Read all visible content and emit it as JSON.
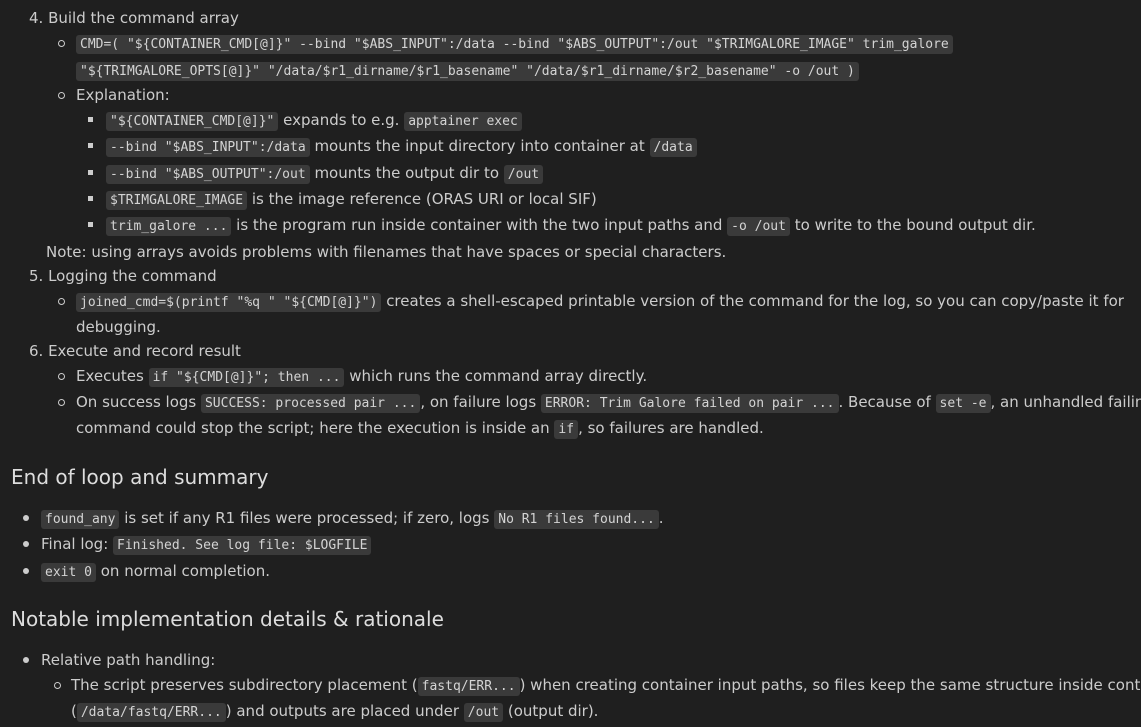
{
  "steps": {
    "step4_title": "4. Build the command array",
    "cmd_code_1": "CMD=( \"${CONTAINER_CMD[@]}\" --bind \"$ABS_INPUT\":/data --bind \"$ABS_OUTPUT\":/out \"$TRIMGALORE_IMAGE\" trim_galore",
    "cmd_code_2": "\"${TRIMGALORE_OPTS[@]}\" \"/data/$r1_dirname/$r1_basename\" \"/data/$r1_dirname/$r2_basename\" -o /out )",
    "explanation_label": "Explanation:",
    "exp1_code": "\"${CONTAINER_CMD[@]}\"",
    "exp1_text": " expands to e.g. ",
    "exp1_code2": "apptainer exec",
    "exp2_code": "--bind \"$ABS_INPUT\":/data",
    "exp2_text": " mounts the input directory into container at ",
    "exp2_code2": "/data",
    "exp3_code": "--bind \"$ABS_OUTPUT\":/out",
    "exp3_text": " mounts the output dir to ",
    "exp3_code2": "/out",
    "exp4_code": "$TRIMGALORE_IMAGE",
    "exp4_text": " is the image reference (ORAS URI or local SIF)",
    "exp5_code": "trim_galore ...",
    "exp5_text": " is the program run inside container with the two input paths and ",
    "exp5_code2": "-o /out",
    "exp5_text2": " to write to the bound output dir.",
    "note": "Note: using arrays avoids problems with filenames that have spaces or special characters.",
    "step5_title": "5. Logging the command",
    "log_code": "joined_cmd=$(printf \"%q \" \"${CMD[@]}\")",
    "log_text": " creates a shell-escaped printable version of the command for the log, so you can copy/paste it for",
    "log_text2": "debugging.",
    "step6_title": "6. Execute and record result",
    "exec_text1": "Executes ",
    "exec_code": "if \"${CMD[@]}\"; then ...",
    "exec_text2": " which runs the command array directly.",
    "succ_text1": "On success logs ",
    "succ_code": "SUCCESS: processed pair ...",
    "succ_text2": ", on failure logs ",
    "succ_code2": "ERROR: Trim Galore failed on pair ...",
    "succ_text3": ". Because of ",
    "succ_code3": "set -e",
    "succ_text4": ", an unhandled failin",
    "succ_line2a": "command could stop the script; here the execution is inside an ",
    "succ_line2_code": "if",
    "succ_line2b": ", so failures are handled."
  },
  "end_section": {
    "heading": "End of loop and summary",
    "b1_code": "found_any",
    "b1_text": " is set if any R1 files were processed; if zero, logs ",
    "b1_code2": "No R1 files found...",
    "b1_text2": ".",
    "b2_text": "Final log: ",
    "b2_code": "Finished. See log file: $LOGFILE",
    "b3_code": "exit 0",
    "b3_text": " on normal completion."
  },
  "notable_section": {
    "heading": "Notable implementation details & rationale",
    "b1_text": "Relative path handling:",
    "sub1_text1": "The script preserves subdirectory placement (",
    "sub1_code": "fastq/ERR...",
    "sub1_text2": ") when creating container input paths, so files keep the same structure inside container",
    "sub1_line2a": "(",
    "sub1_line2_code": "/data/fastq/ERR...",
    "sub1_line2b": ") and outputs are placed under ",
    "sub1_line2_code2": "/out",
    "sub1_line2c": " (output dir)."
  }
}
